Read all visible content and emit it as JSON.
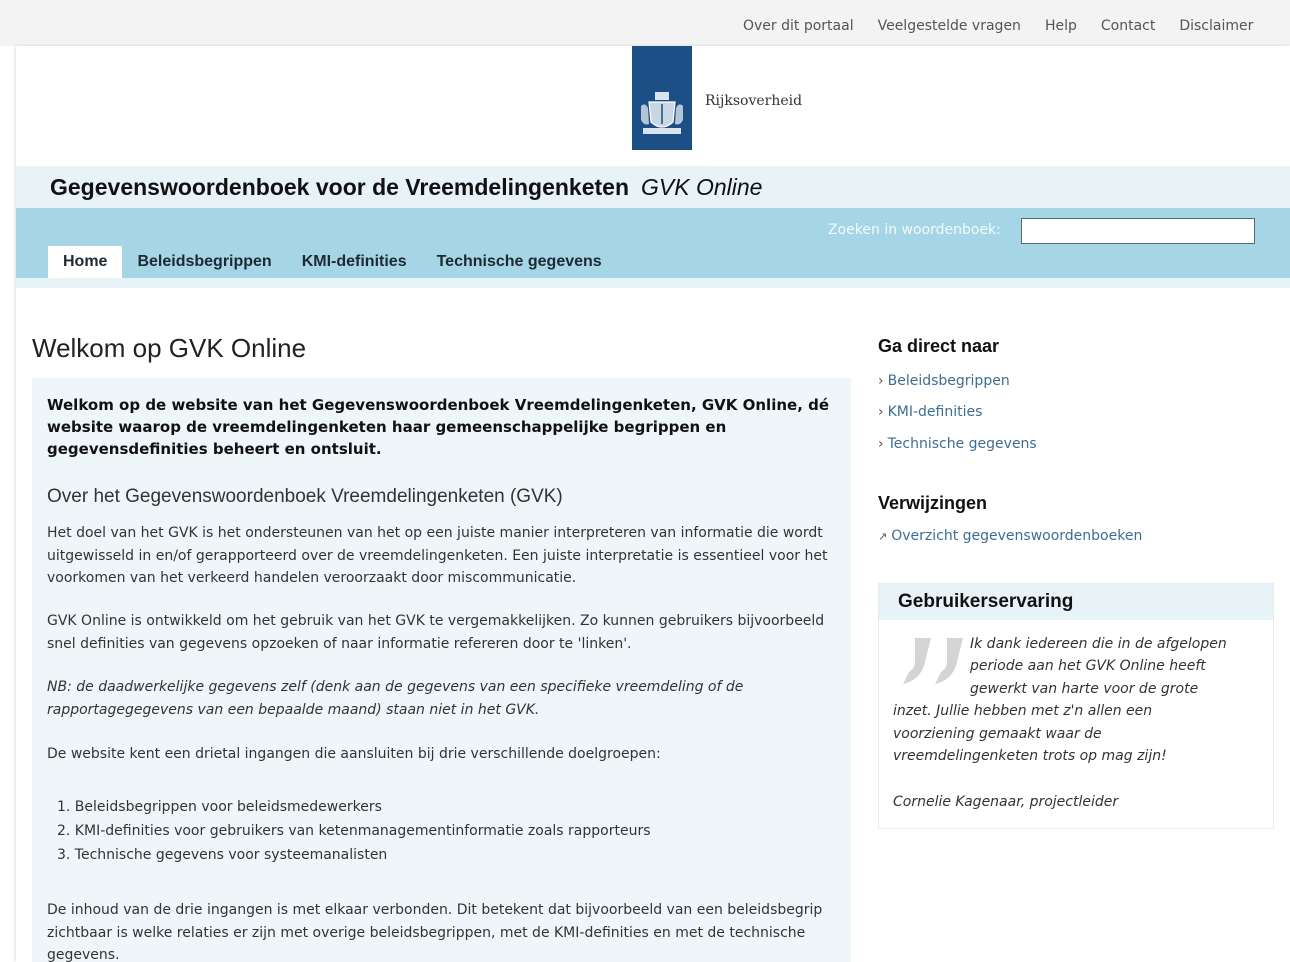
{
  "top_links": [
    "Over dit portaal",
    "Veelgestelde vragen",
    "Help",
    "Contact",
    "Disclaimer"
  ],
  "logo": {
    "text": "Rijksoverheid",
    "color": "#1b4f86"
  },
  "site": {
    "title": "Gegevenswoordenboek voor de Vreemdelingenketen",
    "subtitle": "GVK Online"
  },
  "search": {
    "label": "Zoeken in woordenboek:",
    "value": ""
  },
  "tabs": [
    "Home",
    "Beleidsbegrippen",
    "KMI-definities",
    "Technische gegevens"
  ],
  "main": {
    "title": "Welkom op GVK Online",
    "intro": "Welkom op de website van het Gegevenswoordenboek Vreemdelingenketen, GVK Online, dé website waarop de vreemdelingenketen haar gemeenschappelijke begrippen en gegevensdefinities beheert en ontsluit.",
    "subtitle": "Over het Gegevenswoordenboek Vreemdelingenketen (GVK)",
    "p1": "Het doel van het GVK is het ondersteunen van het op een juiste manier interpreteren van informatie die wordt uitgewisseld in en/of gerapporteerd over de vreemdelingenketen. Een juiste interpretatie is essentieel voor het voorkomen van het verkeerd handelen veroorzaakt door miscommunicatie.",
    "p2": "GVK Online is ontwikkeld om het gebruik van het GVK te vergemakkelijken. Zo kunnen gebruikers bijvoorbeeld snel definities van gegevens opzoeken of naar informatie refereren door te 'linken'.",
    "p3": "NB: de daadwerkelijke gegevens zelf (denk aan de gegevens van een specifieke vreemdeling of de rapportagegegevens van een bepaalde maand) staan niet in het GVK.",
    "p4": "De website kent een drietal ingangen die aansluiten bij drie verschillende doelgroepen:",
    "list": [
      "1.  Beleidsbegrippen voor beleidsmedewerkers",
      "2.  KMI-definities voor gebruikers van ketenmanagementinformatie zoals rapporteurs",
      "3.  Technische gegevens voor systeemanalisten"
    ],
    "p5": "De inhoud van de drie ingangen is met elkaar verbonden. Dit betekent dat bijvoorbeeld van een beleidsbegrip zichtbaar is welke relaties er zijn met overige beleidsbegrippen, met de KMI-definities en met de technische gegevens."
  },
  "sidebar": {
    "direct_title": "Ga direct naar",
    "direct_links": [
      "Beleidsbegrippen",
      "KMI-definities",
      "Technische gegevens"
    ],
    "ref_title": "Verwijzingen",
    "ref_link": "Overzicht gegevenswoordenboeken",
    "exp_title": "Gebruikerservaring",
    "quote_lines": [
      "Ik dank iedereen die in de afgelopen",
      "periode aan het GVK Online heeft",
      "gewerkt van harte voor de grote",
      "inzet. Jullie hebben met z'n allen een",
      "voorziening gemaakt waar de",
      "vreemdelingenketen trots op mag zijn!"
    ],
    "quote_author": "Cornelie Kagenaar, projectleider"
  },
  "colors": {
    "nav_band": "#a6d5e6",
    "title_band": "#e8f3f8",
    "link": "#3d6e92",
    "main_box": "#eef6fa"
  }
}
